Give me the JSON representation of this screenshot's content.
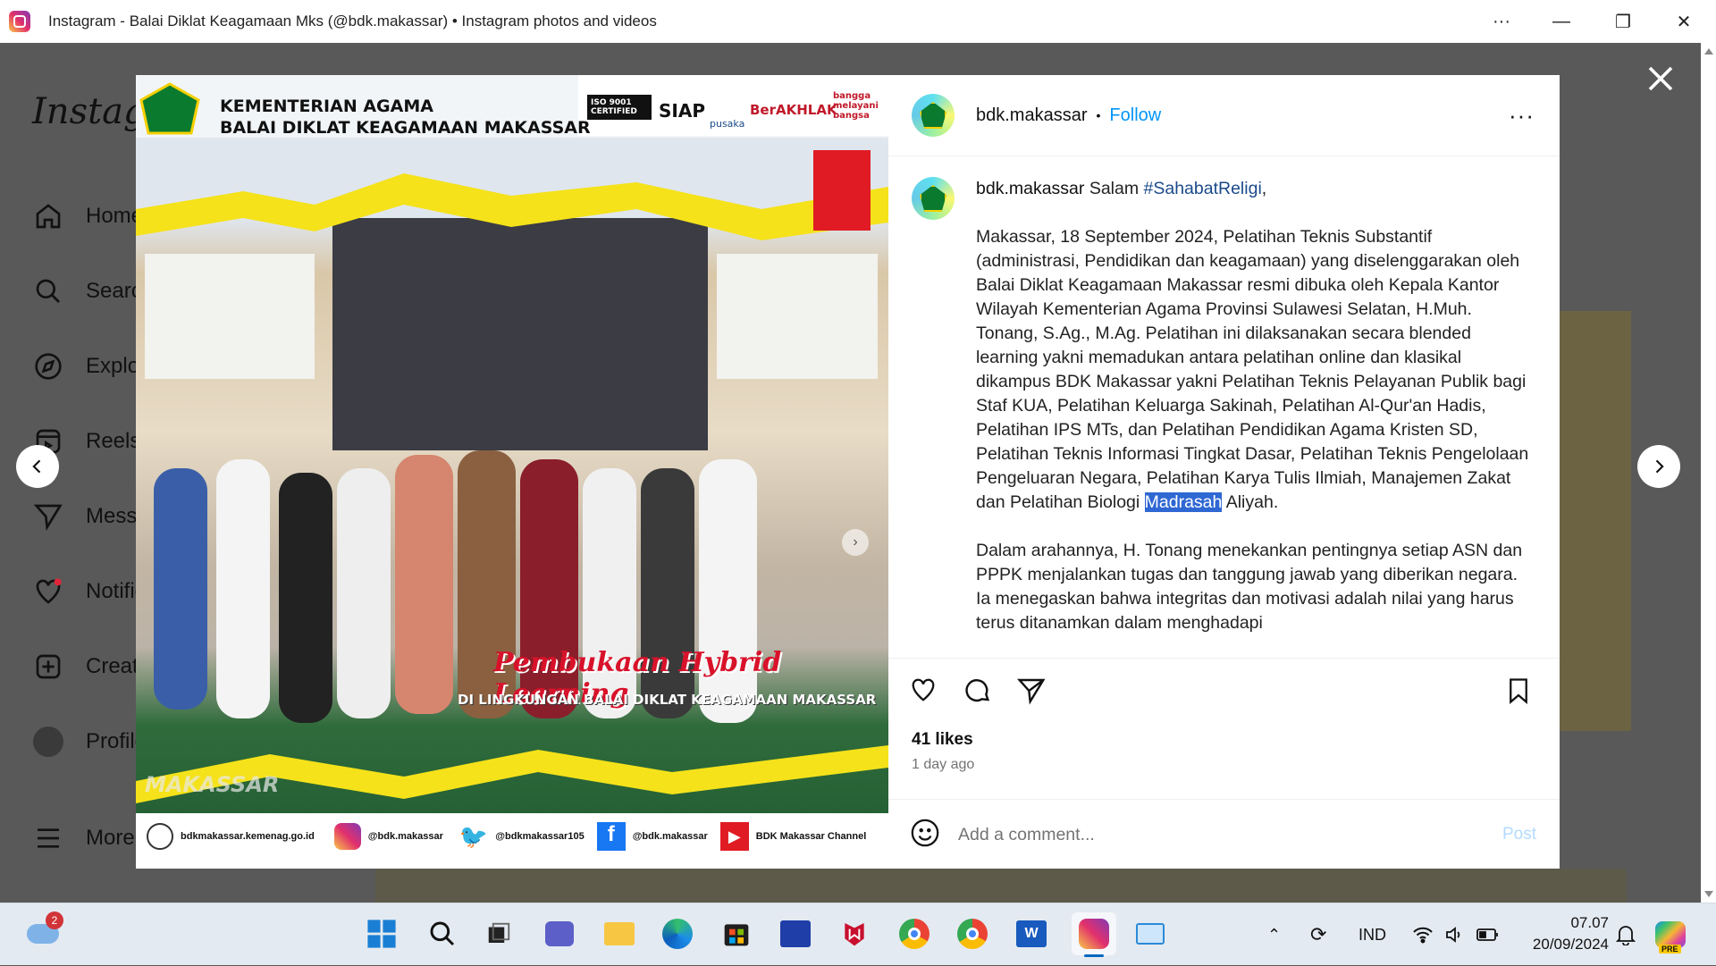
{
  "window": {
    "title": "Instagram - Balai Diklat Keagamaan Mks (@bdk.makassar) • Instagram photos and videos",
    "more": "···",
    "minimize": "—",
    "restore": "❐",
    "close": "✕"
  },
  "sidebar": {
    "logo": "Instagram",
    "items": [
      {
        "label": "Home",
        "icon": "home-icon"
      },
      {
        "label": "Search",
        "icon": "search-icon"
      },
      {
        "label": "Explore",
        "icon": "compass-icon"
      },
      {
        "label": "Reels",
        "icon": "reels-icon"
      },
      {
        "label": "Messages",
        "icon": "send-icon"
      },
      {
        "label": "Notifications",
        "icon": "heart-icon"
      },
      {
        "label": "Create",
        "icon": "plus-square-icon"
      },
      {
        "label": "Profile",
        "icon": "avatar-icon"
      },
      {
        "label": "More",
        "icon": "menu-icon"
      }
    ]
  },
  "post": {
    "username": "bdk.makassar",
    "follow": "Follow",
    "options": "···",
    "image": {
      "header_line1": "KEMENTERIAN AGAMA",
      "header_line2": "BALAI DIKLAT KEAGAMAAN MAKASSAR",
      "badges": [
        "ISO 9001 CERTIFIED",
        "SIAP",
        "pusaka",
        "BerAKHLAK",
        "bangga melayani bangsa"
      ],
      "title": "Pembukaan Hybrid Learning",
      "subtitle": "DI LINGKUNGAN BALAI DIKLAT KEAGAMAAN MAKASSAR",
      "watermark": "MAKASSAR",
      "social": [
        "bdkmakassar.kemenag.go.id",
        "@bdk.makassar",
        "@bdkmakassar105",
        "@bdk.makassar",
        "BDK Makassar Channel"
      ]
    },
    "caption": {
      "username": "bdk.makassar",
      "greeting": "Salam",
      "hashtag": "#SahabatReligi",
      "p1_before": "Makassar, 18 September 2024, Pelatihan Teknis Substantif (administrasi, Pendidikan dan keagamaan) yang diselenggarakan oleh Balai Diklat Keagamaan Makassar resmi dibuka oleh Kepala Kantor Wilayah Kementerian Agama Provinsi Sulawesi Selatan, H.Muh. Tonang, S.Ag., M.Ag. Pelatihan ini dilaksanakan secara blended learning yakni memadukan antara pelatihan online dan klasikal dikampus BDK Makassar yakni Pelatihan Teknis Pelayanan Publik bagi Staf KUA, Pelatihan Keluarga Sakinah, Pelatihan Al-Qur'an Hadis, Pelatihan IPS MTs, dan Pelatihan Pendidikan Agama Kristen SD, Pelatihan Teknis Informasi Tingkat Dasar, Pelatihan Teknis Pengelolaan Pengeluaran Negara, Pelatihan Karya Tulis Ilmiah, Manajemen Zakat dan Pelatihan Biologi",
      "p1_highlight": "Madrasah",
      "p1_after": "Aliyah.",
      "p2": "Dalam arahannya, H. Tonang menekankan pentingnya setiap ASN dan PPPK menjalankan tugas dan tanggung jawab yang diberikan negara. Ia menegaskan bahwa integritas dan motivasi adalah nilai yang harus terus ditanamkan dalam menghadapi"
    },
    "likes": "41 likes",
    "time": "1 day ago",
    "comment": {
      "placeholder": "Add a comment...",
      "post": "Post"
    }
  },
  "taskbar": {
    "weather_badge": "2",
    "apps": [
      "start",
      "search",
      "task-view",
      "teams",
      "file-explorer",
      "edge",
      "store",
      "app",
      "mcafee",
      "chrome",
      "chrome-profile",
      "word",
      "instagram",
      "app-2"
    ],
    "language": "IND",
    "time": "07.07",
    "date": "20/09/2024",
    "copilot_badge": "PRE"
  },
  "colors": {
    "follow": "#0095f6",
    "hashtag": "#1a4a8a",
    "selection": "#2f67d3",
    "post_disabled": "#b3dbff"
  }
}
